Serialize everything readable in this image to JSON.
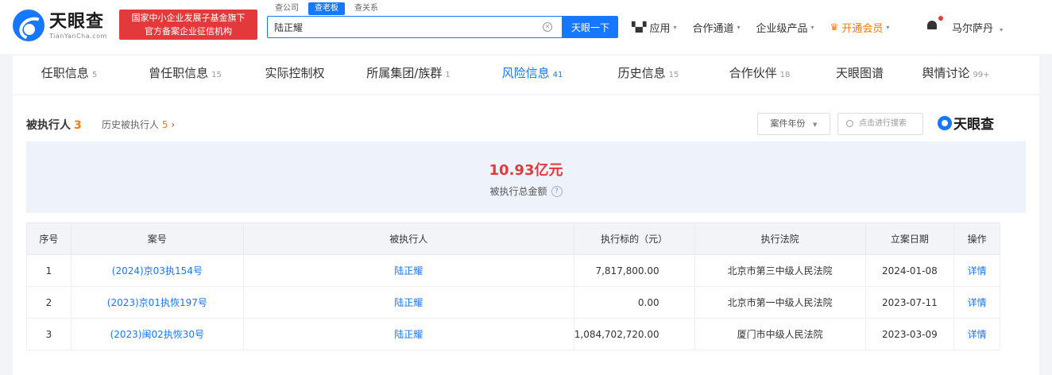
{
  "header": {
    "logo_cn": "天眼查",
    "logo_en": "TianYanCha.com",
    "gov_badge_line1": "国家中小企业发展子基金旗下",
    "gov_badge_line2": "官方备案企业征信机构",
    "search_tabs": [
      "查公司",
      "查老板",
      "查关系"
    ],
    "search_value": "陆正耀",
    "search_button": "天眼一下",
    "nav": {
      "apps": "应用",
      "partner": "合作通道",
      "enterprise": "企业级产品",
      "vip": "开通会员"
    },
    "user": "马尔萨丹"
  },
  "tabs": [
    {
      "label": "任职信息",
      "count": "5"
    },
    {
      "label": "曾任职信息",
      "count": "15"
    },
    {
      "label": "实际控制权",
      "count": ""
    },
    {
      "label": "所属集团/族群",
      "count": "1"
    },
    {
      "label": "风险信息",
      "count": "41"
    },
    {
      "label": "历史信息",
      "count": "15"
    },
    {
      "label": "合作伙伴",
      "count": "18"
    },
    {
      "label": "天眼图谱",
      "count": ""
    },
    {
      "label": "舆情讨论",
      "count": "99+"
    }
  ],
  "section": {
    "title": "被执行人",
    "count": "3",
    "history_label": "历史被执行人",
    "history_count": "5",
    "filter_label": "案件年份",
    "search_placeholder": "点击进行搜索",
    "brand": "天眼查"
  },
  "summary": {
    "amount": "10.93亿元",
    "label": "被执行总金额"
  },
  "table": {
    "headers": [
      "序号",
      "案号",
      "被执行人",
      "执行标的（元）",
      "执行法院",
      "立案日期",
      "操作"
    ],
    "rows": [
      {
        "no": "1",
        "case": "(2024)京03执154号",
        "person": "陆正耀",
        "amount": "7,817,800.00",
        "court": "北京市第三中级人民法院",
        "date": "2024-01-08",
        "action": "详情"
      },
      {
        "no": "2",
        "case": "(2023)京01执恢197号",
        "person": "陆正耀",
        "amount": "0.00",
        "court": "北京市第一中级人民法院",
        "date": "2023-07-11",
        "action": "详情"
      },
      {
        "no": "3",
        "case": "(2023)闽02执恢30号",
        "person": "陆正耀",
        "amount": "1,084,702,720.00",
        "court": "厦门市中级人民法院",
        "date": "2023-03-09",
        "action": "详情"
      }
    ]
  },
  "colors": {
    "accent": "#1677ff",
    "danger": "#e4393c",
    "warning": "#ff7a00"
  }
}
